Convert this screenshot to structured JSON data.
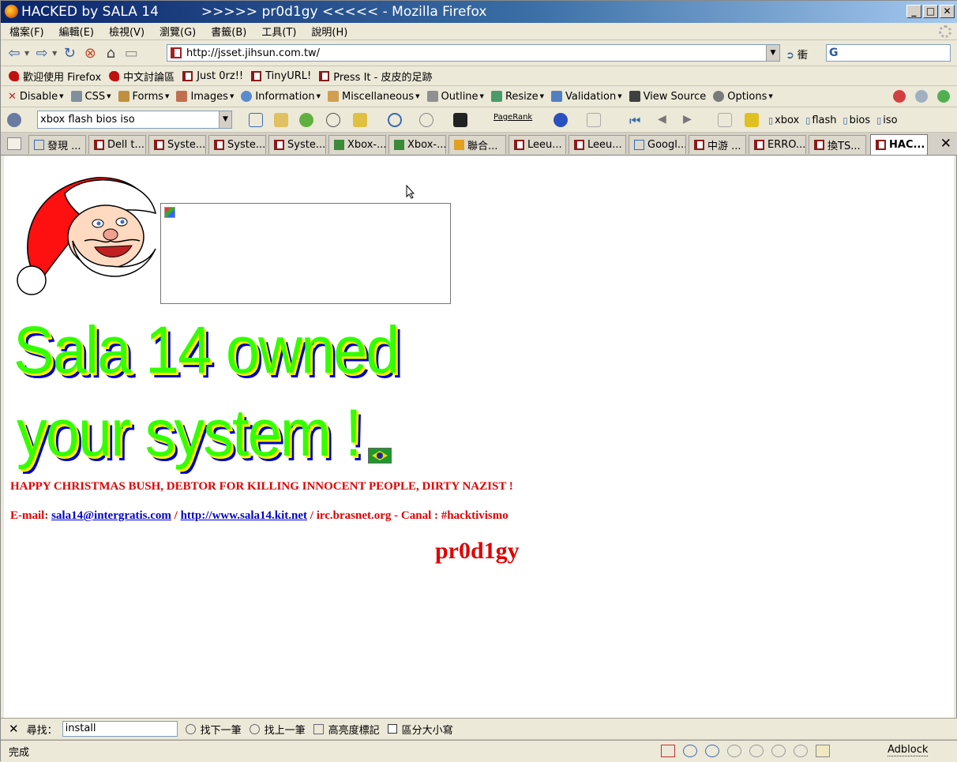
{
  "window": {
    "title": "HACKED by SALA 14          >>>>> pr0d1gy <<<<< - Mozilla Firefox",
    "minimize": "_",
    "maximize": "□",
    "close": "✕"
  },
  "menu": [
    "檔案(F)",
    "編輯(E)",
    "檢視(V)",
    "瀏覽(G)",
    "書籤(B)",
    "工具(T)",
    "說明(H)"
  ],
  "nav": {
    "url": "http://jsset.jihsun.com.tw/",
    "go_label": "衝",
    "search_value": ""
  },
  "bookmarks": [
    "歡迎使用 Firefox",
    "中文討論區",
    "Just 0rz!!",
    "TinyURL!",
    "Press It - 皮皮的足跡"
  ],
  "devbar": [
    "Disable",
    "CSS",
    "Forms",
    "Images",
    "Information",
    "Miscellaneous",
    "Outline",
    "Resize",
    "Validation",
    "View Source",
    "Options"
  ],
  "google": {
    "query": "xbox flash bios iso",
    "pagerank": "PageRank",
    "words": [
      "xbox",
      "flash",
      "bios",
      "iso"
    ]
  },
  "tabs": [
    "發現 ...",
    "Dell t...",
    "Syste...",
    "Syste...",
    "Syste...",
    "Xbox-...",
    "Xbox-...",
    "聯合...",
    "Leeu...",
    "Leeu...",
    "Googl...",
    "中游 ...",
    "ERRO...",
    "換TS...",
    "HAC..."
  ],
  "page": {
    "headline1": "Sala 14 owned",
    "headline2": "your system !",
    "message": "HAPPY CHRISTMAS BUSH, DEBTOR FOR KILLING INNOCENT PEOPLE, DIRTY NAZIST !",
    "email_label": "E-mail:",
    "email": "sala14@intergratis.com",
    "sep1": " / ",
    "site": "http://www.sala14.kit.net",
    "sep2": " / irc.brasnet.org - Canal : #hacktivismo",
    "signature": "pr0d1gy"
  },
  "find": {
    "close": "✕",
    "label": "尋找：",
    "value": "install",
    "next": "找下一筆",
    "prev": "找上一筆",
    "highlight": "高亮度標記",
    "match_case": "區分大小寫"
  },
  "status": {
    "text": "完成",
    "adblock": "Adblock"
  }
}
